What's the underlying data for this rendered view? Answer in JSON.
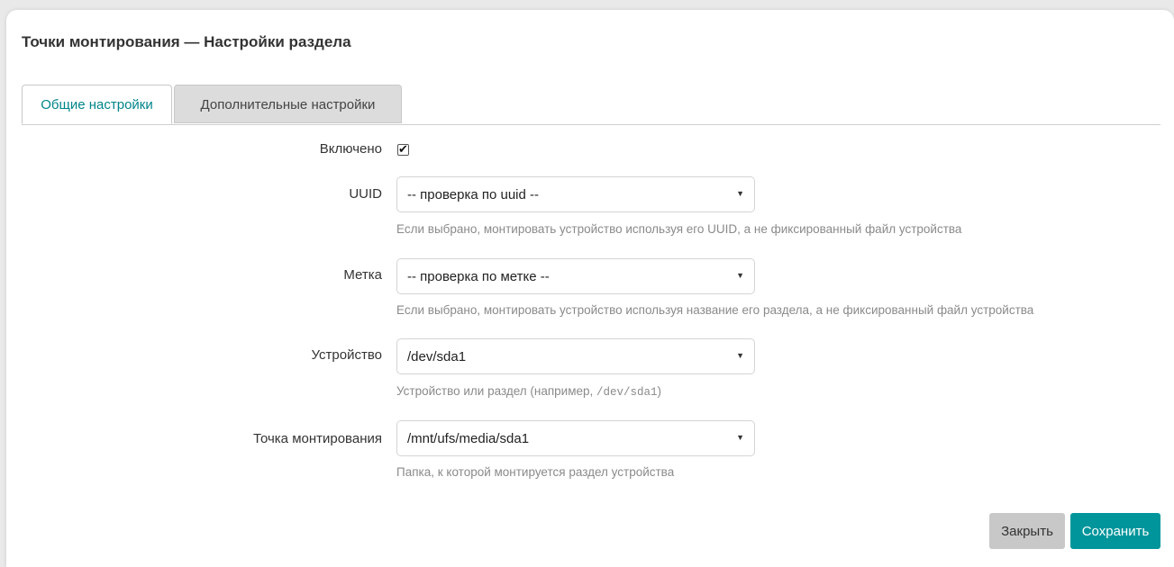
{
  "dialog": {
    "title": "Точки монтирования — Настройки раздела"
  },
  "tabs": [
    {
      "label": "Общие настройки",
      "active": true
    },
    {
      "label": "Дополнительные настройки",
      "active": false
    }
  ],
  "fields": {
    "enabled": {
      "label": "Включено",
      "checked": true
    },
    "uuid": {
      "label": "UUID",
      "value": "-- проверка по uuid --",
      "hint": "Если выбрано, монтировать устройство используя его UUID, а не фиксированный файл устройства"
    },
    "label_field": {
      "label": "Метка",
      "value": "-- проверка по метке --",
      "hint": "Если выбрано, монтировать устройство используя название его раздела, а не фиксированный файл устройства"
    },
    "device": {
      "label": "Устройство",
      "value": "/dev/sda1",
      "hint_prefix": "Устройство или раздел (например, ",
      "hint_code": "/dev/sda1",
      "hint_suffix": ")"
    },
    "mountpoint": {
      "label": "Точка монтирования",
      "value": "/mnt/ufs/media/sda1",
      "hint": "Папка, к которой монтируется раздел устройства"
    }
  },
  "buttons": {
    "close": "Закрыть",
    "save": "Сохранить"
  },
  "colors": {
    "accent": "#00959b",
    "active_tab_text": "#00858b",
    "inactive_tab_bg": "#dcdcdc",
    "close_button_bg": "#c8c8c8"
  },
  "icons": {
    "caret": "chevron-down-icon",
    "check": "checkmark-icon"
  }
}
